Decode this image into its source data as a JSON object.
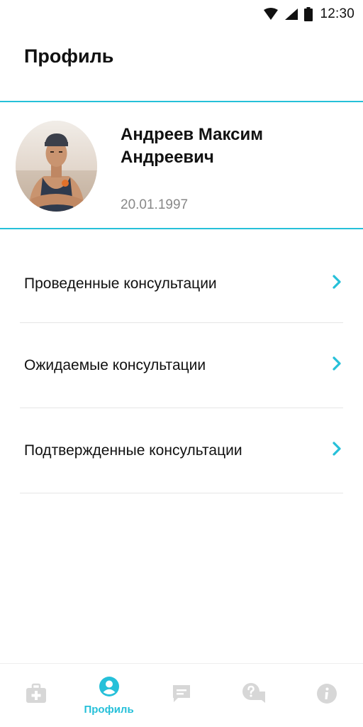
{
  "status_bar": {
    "time": "12:30",
    "icons": [
      "wifi-icon",
      "signal-icon",
      "battery-icon"
    ]
  },
  "header": {
    "title": "Профиль"
  },
  "profile": {
    "name": "Андреев Максим Андреевич",
    "dob": "20.01.1997"
  },
  "menu": {
    "items": [
      {
        "label": "Проведенные консультации",
        "icon": "chevron-right-icon"
      },
      {
        "label": "Ожидаемые консультации",
        "icon": "chevron-right-icon"
      },
      {
        "label": "Подтвержденные консультации",
        "icon": "chevron-right-icon"
      }
    ]
  },
  "bottom_nav": {
    "items": [
      {
        "icon": "first-aid-kit-icon",
        "label": "",
        "active": false
      },
      {
        "icon": "profile-icon",
        "label": "Профиль",
        "active": true
      },
      {
        "icon": "chat-icon",
        "label": "",
        "active": false
      },
      {
        "icon": "question-icon",
        "label": "",
        "active": false
      },
      {
        "icon": "info-icon",
        "label": "",
        "active": false
      }
    ]
  },
  "colors": {
    "accent": "#26C0D9",
    "inactive_icon": "#D7D7D7",
    "divider": "#E6E6E6",
    "secondary_text": "#888888"
  }
}
